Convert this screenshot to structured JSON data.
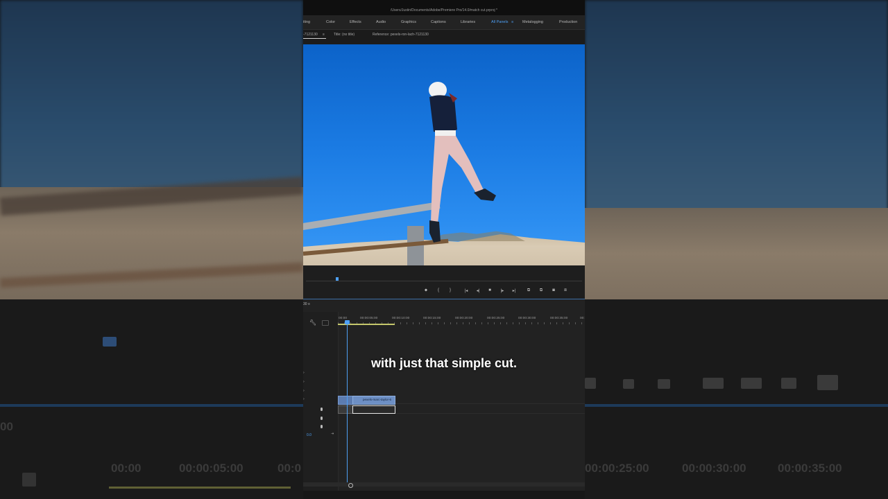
{
  "window": {
    "path": "/Users/Justin/Documents/Adobe/Premiere Pro/14.0/match cut.prproj *"
  },
  "workspaces": [
    {
      "label": "iting",
      "active": false
    },
    {
      "label": "Color",
      "active": false
    },
    {
      "label": "Effects",
      "active": false
    },
    {
      "label": "Audio",
      "active": false
    },
    {
      "label": "Graphics",
      "active": false
    },
    {
      "label": "Captions",
      "active": false
    },
    {
      "label": "Libraries",
      "active": false
    },
    {
      "label": "All Panels",
      "active": true
    },
    {
      "label": "Metalogging",
      "active": false
    },
    {
      "label": "Production",
      "active": false
    }
  ],
  "panel_header": {
    "sequence_tab": "-7121130",
    "title": "Title: (no title)",
    "reference": "Reference: pexels-ron-lach-7121130"
  },
  "timeline": {
    "tab": "30",
    "ruler": [
      "00:00",
      "00:00:05:00",
      "00:00:10:00",
      "00:00:15:00",
      "00:00:20:00",
      "00:00:25:00",
      "00:00:30:00",
      "00:00:35:00",
      "00:"
    ],
    "video_clip_label": "pexels-marc-taylor-6",
    "timecode_small": "0.0"
  },
  "caption": "with just that simple cut.",
  "background_ghost": {
    "left_ruler": [
      "00:00",
      "00:00:05:00",
      "00:0"
    ],
    "right_ruler": [
      "00:00:25:00",
      "00:00:30:00",
      "00:00:35:00"
    ],
    "left_number": "00"
  },
  "colors": {
    "accent": "#4ea0f5",
    "workarea": "#c5c76c",
    "clip_video": "#6d8fc4"
  }
}
